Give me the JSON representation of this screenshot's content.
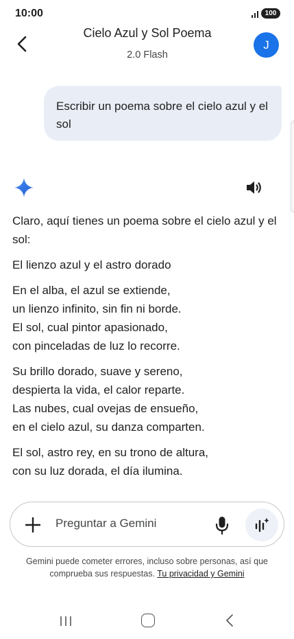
{
  "status_bar": {
    "time": "10:00",
    "battery": "100"
  },
  "header": {
    "title": "Cielo Azul y Sol Poema",
    "subtitle": "2.0 Flash",
    "avatar_initial": "J"
  },
  "user_message": "Escribir un poema sobre el cielo azul y el sol",
  "response": {
    "intro": "Claro, aquí tienes un poema sobre el cielo azul y el sol:",
    "poem_title": "El lienzo azul y el astro dorado",
    "stanzas": [
      [
        "En el alba, el azul se extiende,",
        "un lienzo infinito, sin fin ni borde.",
        "El sol, cual pintor apasionado,",
        "con pinceladas de luz lo recorre."
      ],
      [
        "Su brillo dorado, suave y sereno,",
        "despierta la vida, el calor reparte.",
        "Las nubes, cual ovejas de ensueño,",
        "en el cielo azul, su danza comparten."
      ],
      [
        "El sol, astro rey, en su trono de altura,",
        "con su luz dorada, el día ilumina."
      ]
    ]
  },
  "input": {
    "placeholder": "Preguntar a Gemini"
  },
  "disclaimer": {
    "text": "Gemini puede cometer errores, incluso sobre personas, así que comprueba sus respuestas. ",
    "link": "Tu privacidad y Gemini"
  },
  "colors": {
    "accent": "#1a73e8",
    "bubble": "#e9eef6",
    "text": "#1f1f1f"
  },
  "icons": [
    "back-arrow-icon",
    "gemini-spark-icon",
    "speaker-icon",
    "plus-icon",
    "mic-icon",
    "live-waveform-icon",
    "nav-recent-icon",
    "nav-home-icon",
    "nav-back-icon"
  ]
}
